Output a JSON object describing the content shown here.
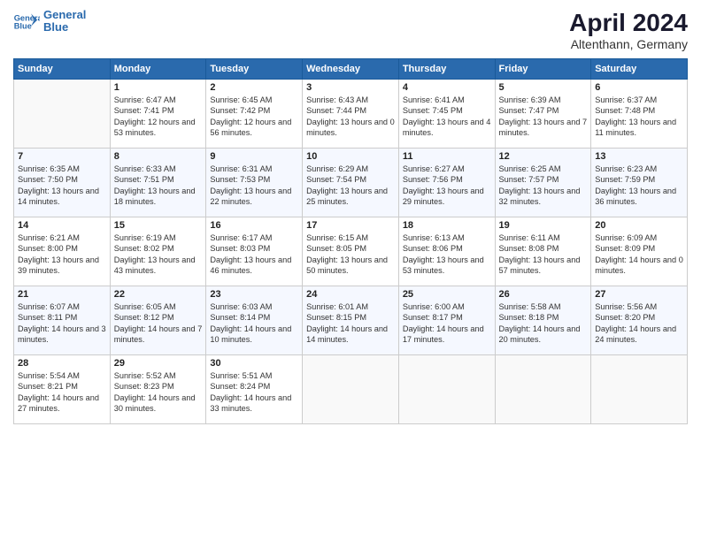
{
  "header": {
    "logo_line1": "General",
    "logo_line2": "Blue",
    "title": "April 2024",
    "subtitle": "Altenthann, Germany"
  },
  "days_of_week": [
    "Sunday",
    "Monday",
    "Tuesday",
    "Wednesday",
    "Thursday",
    "Friday",
    "Saturday"
  ],
  "weeks": [
    [
      {
        "day": "",
        "empty": true
      },
      {
        "day": "1",
        "sunrise": "Sunrise: 6:47 AM",
        "sunset": "Sunset: 7:41 PM",
        "daylight": "Daylight: 12 hours and 53 minutes."
      },
      {
        "day": "2",
        "sunrise": "Sunrise: 6:45 AM",
        "sunset": "Sunset: 7:42 PM",
        "daylight": "Daylight: 12 hours and 56 minutes."
      },
      {
        "day": "3",
        "sunrise": "Sunrise: 6:43 AM",
        "sunset": "Sunset: 7:44 PM",
        "daylight": "Daylight: 13 hours and 0 minutes."
      },
      {
        "day": "4",
        "sunrise": "Sunrise: 6:41 AM",
        "sunset": "Sunset: 7:45 PM",
        "daylight": "Daylight: 13 hours and 4 minutes."
      },
      {
        "day": "5",
        "sunrise": "Sunrise: 6:39 AM",
        "sunset": "Sunset: 7:47 PM",
        "daylight": "Daylight: 13 hours and 7 minutes."
      },
      {
        "day": "6",
        "sunrise": "Sunrise: 6:37 AM",
        "sunset": "Sunset: 7:48 PM",
        "daylight": "Daylight: 13 hours and 11 minutes."
      }
    ],
    [
      {
        "day": "7",
        "sunrise": "Sunrise: 6:35 AM",
        "sunset": "Sunset: 7:50 PM",
        "daylight": "Daylight: 13 hours and 14 minutes."
      },
      {
        "day": "8",
        "sunrise": "Sunrise: 6:33 AM",
        "sunset": "Sunset: 7:51 PM",
        "daylight": "Daylight: 13 hours and 18 minutes."
      },
      {
        "day": "9",
        "sunrise": "Sunrise: 6:31 AM",
        "sunset": "Sunset: 7:53 PM",
        "daylight": "Daylight: 13 hours and 22 minutes."
      },
      {
        "day": "10",
        "sunrise": "Sunrise: 6:29 AM",
        "sunset": "Sunset: 7:54 PM",
        "daylight": "Daylight: 13 hours and 25 minutes."
      },
      {
        "day": "11",
        "sunrise": "Sunrise: 6:27 AM",
        "sunset": "Sunset: 7:56 PM",
        "daylight": "Daylight: 13 hours and 29 minutes."
      },
      {
        "day": "12",
        "sunrise": "Sunrise: 6:25 AM",
        "sunset": "Sunset: 7:57 PM",
        "daylight": "Daylight: 13 hours and 32 minutes."
      },
      {
        "day": "13",
        "sunrise": "Sunrise: 6:23 AM",
        "sunset": "Sunset: 7:59 PM",
        "daylight": "Daylight: 13 hours and 36 minutes."
      }
    ],
    [
      {
        "day": "14",
        "sunrise": "Sunrise: 6:21 AM",
        "sunset": "Sunset: 8:00 PM",
        "daylight": "Daylight: 13 hours and 39 minutes."
      },
      {
        "day": "15",
        "sunrise": "Sunrise: 6:19 AM",
        "sunset": "Sunset: 8:02 PM",
        "daylight": "Daylight: 13 hours and 43 minutes."
      },
      {
        "day": "16",
        "sunrise": "Sunrise: 6:17 AM",
        "sunset": "Sunset: 8:03 PM",
        "daylight": "Daylight: 13 hours and 46 minutes."
      },
      {
        "day": "17",
        "sunrise": "Sunrise: 6:15 AM",
        "sunset": "Sunset: 8:05 PM",
        "daylight": "Daylight: 13 hours and 50 minutes."
      },
      {
        "day": "18",
        "sunrise": "Sunrise: 6:13 AM",
        "sunset": "Sunset: 8:06 PM",
        "daylight": "Daylight: 13 hours and 53 minutes."
      },
      {
        "day": "19",
        "sunrise": "Sunrise: 6:11 AM",
        "sunset": "Sunset: 8:08 PM",
        "daylight": "Daylight: 13 hours and 57 minutes."
      },
      {
        "day": "20",
        "sunrise": "Sunrise: 6:09 AM",
        "sunset": "Sunset: 8:09 PM",
        "daylight": "Daylight: 14 hours and 0 minutes."
      }
    ],
    [
      {
        "day": "21",
        "sunrise": "Sunrise: 6:07 AM",
        "sunset": "Sunset: 8:11 PM",
        "daylight": "Daylight: 14 hours and 3 minutes."
      },
      {
        "day": "22",
        "sunrise": "Sunrise: 6:05 AM",
        "sunset": "Sunset: 8:12 PM",
        "daylight": "Daylight: 14 hours and 7 minutes."
      },
      {
        "day": "23",
        "sunrise": "Sunrise: 6:03 AM",
        "sunset": "Sunset: 8:14 PM",
        "daylight": "Daylight: 14 hours and 10 minutes."
      },
      {
        "day": "24",
        "sunrise": "Sunrise: 6:01 AM",
        "sunset": "Sunset: 8:15 PM",
        "daylight": "Daylight: 14 hours and 14 minutes."
      },
      {
        "day": "25",
        "sunrise": "Sunrise: 6:00 AM",
        "sunset": "Sunset: 8:17 PM",
        "daylight": "Daylight: 14 hours and 17 minutes."
      },
      {
        "day": "26",
        "sunrise": "Sunrise: 5:58 AM",
        "sunset": "Sunset: 8:18 PM",
        "daylight": "Daylight: 14 hours and 20 minutes."
      },
      {
        "day": "27",
        "sunrise": "Sunrise: 5:56 AM",
        "sunset": "Sunset: 8:20 PM",
        "daylight": "Daylight: 14 hours and 24 minutes."
      }
    ],
    [
      {
        "day": "28",
        "sunrise": "Sunrise: 5:54 AM",
        "sunset": "Sunset: 8:21 PM",
        "daylight": "Daylight: 14 hours and 27 minutes."
      },
      {
        "day": "29",
        "sunrise": "Sunrise: 5:52 AM",
        "sunset": "Sunset: 8:23 PM",
        "daylight": "Daylight: 14 hours and 30 minutes."
      },
      {
        "day": "30",
        "sunrise": "Sunrise: 5:51 AM",
        "sunset": "Sunset: 8:24 PM",
        "daylight": "Daylight: 14 hours and 33 minutes."
      },
      {
        "day": "",
        "empty": true
      },
      {
        "day": "",
        "empty": true
      },
      {
        "day": "",
        "empty": true
      },
      {
        "day": "",
        "empty": true
      }
    ]
  ]
}
